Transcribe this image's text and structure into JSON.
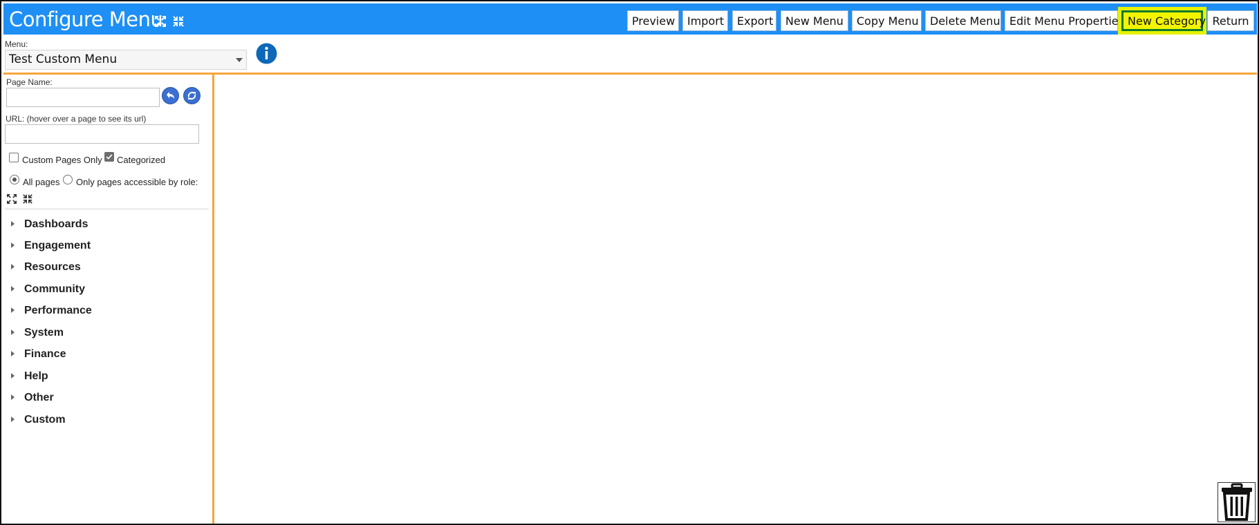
{
  "header": {
    "title": "Configure Menu",
    "buttons": [
      {
        "label": "Preview"
      },
      {
        "label": "Import"
      },
      {
        "label": "Export"
      },
      {
        "label": "New Menu"
      },
      {
        "label": "Copy Menu"
      },
      {
        "label": "Delete Menu"
      },
      {
        "label": "Edit Menu Properties"
      },
      {
        "label": "New Category"
      },
      {
        "label": "Return"
      }
    ]
  },
  "menu": {
    "label": "Menu:",
    "selected": "Test Custom Menu"
  },
  "filters": {
    "page_name_label": "Page Name:",
    "page_name_value": "",
    "url_label": "URL: (hover over a page to see its url)",
    "url_value": "",
    "custom_pages_only_label": "Custom Pages Only",
    "custom_pages_only_checked": false,
    "categorized_label": "Categorized",
    "categorized_checked": true,
    "all_pages_label": "All pages",
    "role_pages_label": "Only pages accessible by role:",
    "scope_selected": "All pages"
  },
  "categories": [
    {
      "label": "Dashboards"
    },
    {
      "label": "Engagement"
    },
    {
      "label": "Resources"
    },
    {
      "label": "Community"
    },
    {
      "label": "Performance"
    },
    {
      "label": "System"
    },
    {
      "label": "Finance"
    },
    {
      "label": "Help"
    },
    {
      "label": "Other"
    },
    {
      "label": "Custom"
    }
  ],
  "colors": {
    "header_bg": "#1e8ff5",
    "accent_rule": "#f7a43a",
    "highlight": "#f2f400",
    "highlight_border": "#0c7a2a"
  },
  "icons": [
    "expand-all-icon",
    "collapse-all-icon",
    "info-icon",
    "undo-icon",
    "refresh-icon",
    "trash-icon"
  ]
}
